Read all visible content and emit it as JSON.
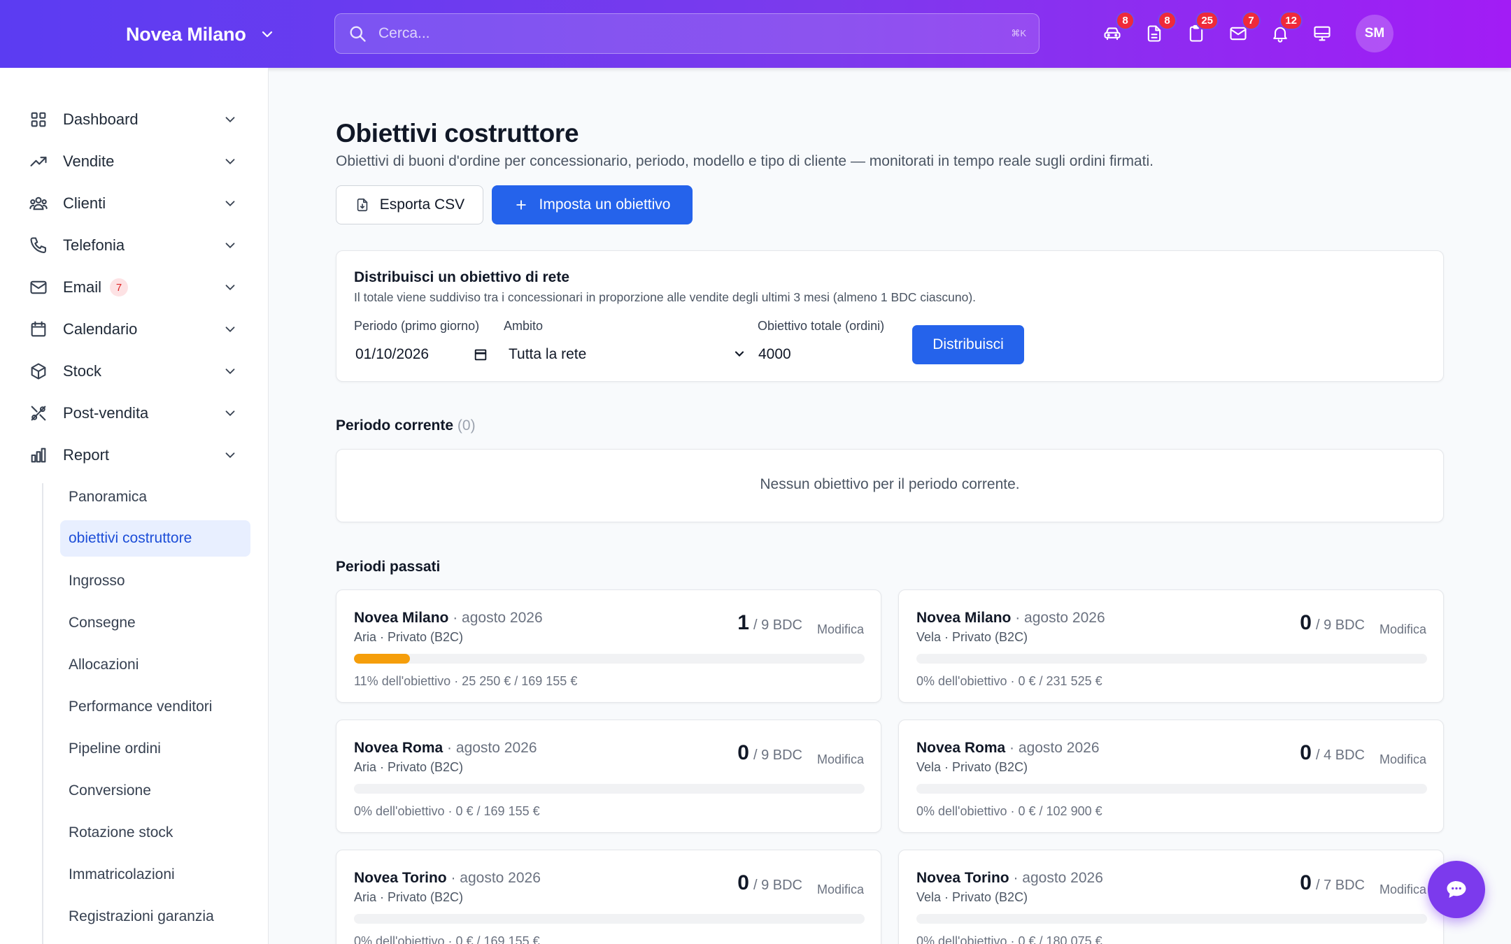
{
  "header": {
    "dealer_name": "Novea Milano",
    "search": {
      "placeholder": "Cerca...",
      "shortcut": "⌘K"
    },
    "icons": [
      {
        "name": "car-icon",
        "badge": "8"
      },
      {
        "name": "document-icon",
        "badge": "8"
      },
      {
        "name": "clipboard-icon",
        "badge": "25"
      },
      {
        "name": "mail-icon",
        "badge": "7"
      },
      {
        "name": "bell-icon",
        "badge": "12"
      },
      {
        "name": "monitor-icon",
        "badge": ""
      }
    ],
    "avatar": "SM"
  },
  "sidebar": {
    "items": [
      {
        "label": "Dashboard",
        "icon": "grid-icon"
      },
      {
        "label": "Vendite",
        "icon": "trending-up-icon"
      },
      {
        "label": "Clienti",
        "icon": "users-icon"
      },
      {
        "label": "Telefonia",
        "icon": "phone-icon"
      },
      {
        "label": "Email",
        "icon": "mail-icon",
        "badge": "7"
      },
      {
        "label": "Calendario",
        "icon": "calendar-icon"
      },
      {
        "label": "Stock",
        "icon": "box-icon"
      },
      {
        "label": "Post-vendita",
        "icon": "tools-icon"
      },
      {
        "label": "Report",
        "icon": "bar-chart-icon"
      }
    ],
    "report_sub": [
      "Panoramica",
      "obiettivi costruttore",
      "Ingrosso",
      "Consegne",
      "Allocazioni",
      "Performance venditori",
      "Pipeline ordini",
      "Conversione",
      "Rotazione stock",
      "Immatricolazioni",
      "Registrazioni garanzia"
    ],
    "active_sub": "obiettivi costruttore"
  },
  "main": {
    "title": "Obiettivi costruttore",
    "subtitle": "Obiettivi di buoni d'ordine per concessionario, periodo, modello e tipo di cliente — monitorati in tempo reale sugli ordini firmati.",
    "export_label": "Esporta CSV",
    "set_goal_label": "Imposta un obiettivo",
    "distribute": {
      "title": "Distribuisci un obiettivo di rete",
      "description": "Il totale viene suddiviso tra i concessionari in proporzione alle vendite degli ultimi 3 mesi (almeno 1 BDC ciascuno).",
      "period_label": "Periodo (primo giorno)",
      "period_value": "01/10/2026",
      "scope_label": "Ambito",
      "scope_value": "Tutta la rete",
      "total_label": "Obiettivo totale (ordini)",
      "total_value": "4000",
      "button": "Distribuisci"
    },
    "current": {
      "title": "Periodo corrente",
      "count": "(0)",
      "empty": "Nessun obiettivo per il periodo corrente."
    },
    "past": {
      "title": "Periodi passati",
      "cards": [
        {
          "dealer": "Novea Milano",
          "period": "agosto 2026",
          "sub": "Aria · Privato (B2C)",
          "achieved": "1",
          "target": "/ 9 BDC",
          "edit": "Modifica",
          "progress": 0.11,
          "footer": "11% dell'obiettivo · 25 250 € / 169 155 €"
        },
        {
          "dealer": "Novea Milano",
          "period": "agosto 2026",
          "sub": "Vela · Privato (B2C)",
          "achieved": "0",
          "target": "/ 9 BDC",
          "edit": "Modifica",
          "progress": 0,
          "footer": "0% dell'obiettivo · 0 € / 231 525 €"
        },
        {
          "dealer": "Novea Roma",
          "period": "agosto 2026",
          "sub": "Aria · Privato (B2C)",
          "achieved": "0",
          "target": "/ 9 BDC",
          "edit": "Modifica",
          "progress": 0,
          "footer": "0% dell'obiettivo · 0 € / 169 155 €"
        },
        {
          "dealer": "Novea Roma",
          "period": "agosto 2026",
          "sub": "Vela · Privato (B2C)",
          "achieved": "0",
          "target": "/ 4 BDC",
          "edit": "Modifica",
          "progress": 0,
          "footer": "0% dell'obiettivo · 0 € / 102 900 €"
        },
        {
          "dealer": "Novea Torino",
          "period": "agosto 2026",
          "sub": "Aria · Privato (B2C)",
          "achieved": "0",
          "target": "/ 9 BDC",
          "edit": "Modifica",
          "progress": 0,
          "footer": "0% dell'obiettivo · 0 € / 169 155 €"
        },
        {
          "dealer": "Novea Torino",
          "period": "agosto 2026",
          "sub": "Vela · Privato (B2C)",
          "achieved": "0",
          "target": "/ 7 BDC",
          "edit": "Modifica",
          "progress": 0,
          "footer": "0% dell'obiettivo · 0 € / 180 075 €"
        }
      ]
    }
  },
  "colors": {
    "accent": "#2563eb",
    "header_start": "#5b3cf2",
    "header_end": "#a21cf5",
    "badge": "#ef2a3a",
    "progress": "#f59e0b"
  },
  "chat_icon": "chat-bubble-icon"
}
